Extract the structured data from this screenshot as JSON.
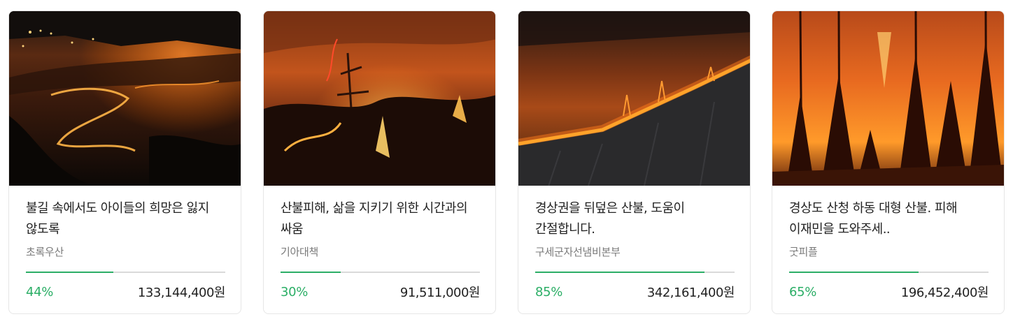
{
  "campaigns": [
    {
      "title": "불길 속에서도 아이들의 희망은 잃지 않도록",
      "org": "초록우산",
      "percent_label": "44%",
      "progress": 0.44,
      "amount": "133,144,400원",
      "image": "night-wildfire-hillside-photo"
    },
    {
      "title": "산불피해, 삶을 지키기 위한 시간과의 싸움",
      "org": "기아대책",
      "percent_label": "30%",
      "progress": 0.3,
      "amount": "91,511,000원",
      "image": "burning-forest-smoke-photo"
    },
    {
      "title": "경상권을 뒤덮은 산불, 도움이 간절합니다.",
      "org": "구세군자선냄비본부",
      "percent_label": "85%",
      "progress": 0.85,
      "amount": "342,161,400원",
      "image": "fire-line-on-slope-photo"
    },
    {
      "title": "경상도 산청 하동 대형 산불. 피해 이재민을 도와주세..",
      "org": "굿피플",
      "percent_label": "65%",
      "progress": 0.65,
      "amount": "196,452,400원",
      "image": "blazing-pine-forest-photo"
    }
  ],
  "colors": {
    "accent": "#2bae66",
    "track": "#d9d9d9",
    "text": "#222222",
    "muted": "#7a7a7a"
  }
}
